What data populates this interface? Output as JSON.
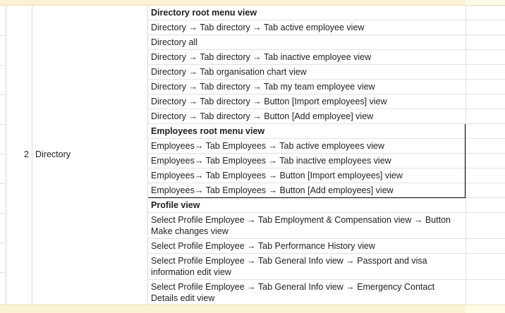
{
  "row_number": "2",
  "section": "Directory",
  "rows": [
    {
      "text": "Directory root menu view",
      "bold": true
    },
    {
      "text": "Directory → Tab directory → Tab active employee view"
    },
    {
      "text": "Directory all"
    },
    {
      "text": "Directory → Tab directory → Tab inactive employee view"
    },
    {
      "text": "Directory → Tab organisation chart view"
    },
    {
      "text": "Directory → Tab directory → Tab my team employee view"
    },
    {
      "text": "Directory → Tab directory → Button [Import employees] view"
    },
    {
      "text": "Directory → Tab directory → Button [Add employee] view"
    },
    {
      "text": "Employees root menu view",
      "bold": true
    },
    {
      "text": "Employees→ Tab Employees → Tab active employees view"
    },
    {
      "text": "Employees→ Tab Employees → Tab inactive employees view"
    },
    {
      "text": "Employees→ Tab Employees → Button [Import employees] view"
    },
    {
      "text": "Employees→ Tab Employees → Button [Add employees] view"
    },
    {
      "text": "Profile view",
      "bold": true
    },
    {
      "text": "Select Profile Employee → Tab Employment & Compensation view → Button Make changes view"
    },
    {
      "text": "Select Profile Employee → Tab Performance History view"
    },
    {
      "text": "Select Profile Employee → Tab General Info view → Passport and visa information edit view"
    },
    {
      "text": "Select Profile Employee → Tab General Info view → Emergency Contact Details edit view"
    }
  ]
}
